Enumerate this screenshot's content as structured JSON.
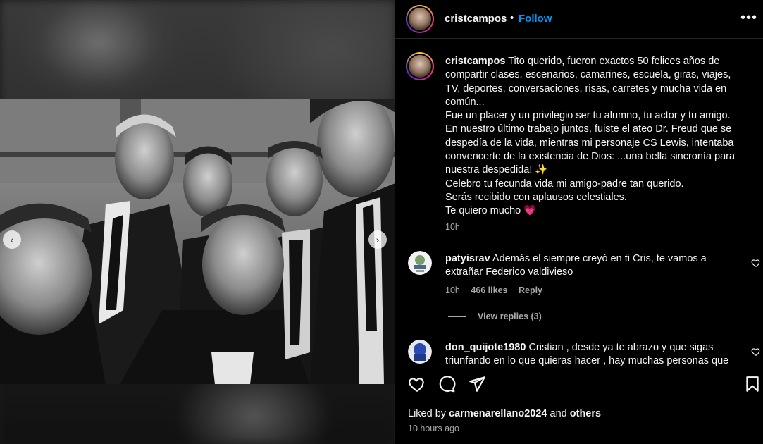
{
  "post": {
    "username": "cristcampos",
    "dot": "•",
    "follow_label": "Follow",
    "more_icon": "•••"
  },
  "caption": {
    "username": "cristcampos",
    "text": "Tito querido, fueron exactos 50 felices años de compartir clases, escenarios, camarines, escuela, giras, viajes, TV, deportes, conversaciones, risas, carretes y mucha vida en común...",
    "lines": [
      "Fue un placer y un privilegio ser tu alumno, tu actor y tu amigo.",
      "En nuestro último trabajo juntos, fuiste el ateo Dr. Freud que se despedía de la vida, mientras mi personaje CS Lewis, intentaba convencerte de la existencia de Dios: ...una bella sincronía para nuestra despedida! ✨",
      "Celebro tu fecunda vida mi amigo-padre tan querido.",
      "Serás recibido con aplausos celestiales.",
      "Te quiero mucho 💗"
    ],
    "time": "10h"
  },
  "comments": [
    {
      "username": "patyisrav",
      "text": "Además el siempre creyó en ti Cris, te vamos a extrañar Federico valdivieso",
      "time": "10h",
      "likes": "466 likes",
      "reply_label": "Reply",
      "view_replies": "View replies (3)"
    },
    {
      "username": "don_quijote1980",
      "text": "Cristian , desde ya te abrazo y que sigas triunfando en lo que quieras hacer , hay muchas personas que"
    }
  ],
  "footer": {
    "liked_by_prefix": "Liked by",
    "liked_by_user": "carmenarellano2024",
    "and_label": "and",
    "others_label": "others",
    "post_time": "10 hours ago"
  },
  "carousel": {
    "prev_icon": "‹",
    "next_icon": "›"
  },
  "colors": {
    "accent": "#0095f6",
    "background": "#000000",
    "text": "#f5f5f5",
    "muted": "#a8a8a8",
    "heart": "#ff3040"
  }
}
